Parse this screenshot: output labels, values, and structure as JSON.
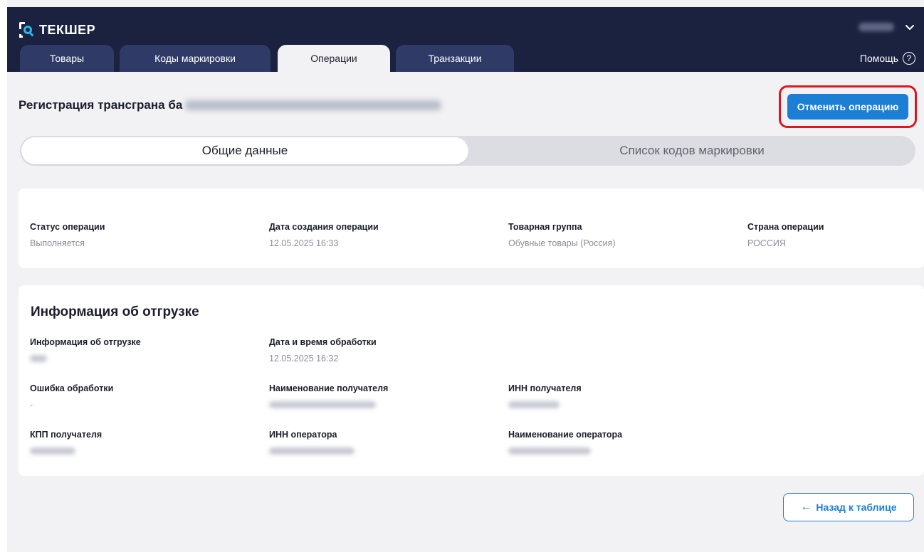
{
  "app": {
    "logo_text": "ТЕКШЕР"
  },
  "header": {
    "tabs": [
      {
        "label": "Товары",
        "active": false
      },
      {
        "label": "Коды маркировки",
        "active": false
      },
      {
        "label": "Операции",
        "active": true
      },
      {
        "label": "Транзакции",
        "active": false
      }
    ],
    "help_label": "Помощь",
    "help_icon_glyph": "?"
  },
  "page": {
    "title": "Регистрация трансграна ба",
    "cancel_label": "Отменить операцию",
    "back_label": "Назад к таблице",
    "back_arrow": "←"
  },
  "segments": [
    {
      "label": "Общие данные",
      "active": true
    },
    {
      "label": "Список кодов маркировки",
      "active": false
    }
  ],
  "status_card": {
    "fields": [
      {
        "label": "Статус операции",
        "value": "Выполняется"
      },
      {
        "label": "Дата создания операции",
        "value": "12.05.2025 16:33"
      },
      {
        "label": "Товарная группа",
        "value": "Обувные товары (Россия)"
      },
      {
        "label": "Страна операции",
        "value": "РОССИЯ"
      }
    ]
  },
  "shipment": {
    "title": "Информация об отгрузке",
    "fields": [
      {
        "label": "Информация об отгрузке"
      },
      {
        "label": "Дата и время обработки",
        "value": "12.05.2025 16:32"
      },
      {
        "label": "Ошибка обработки",
        "value": "-"
      },
      {
        "label": "Наименование получателя"
      },
      {
        "label": "ИНН получателя"
      },
      {
        "label": "КПП получателя"
      },
      {
        "label": "ИНН оператора"
      },
      {
        "label": "Наименование оператора"
      }
    ]
  },
  "colors": {
    "header_bg": "#1b2240",
    "tab_bg": "#2f3a67",
    "accent": "#1c7fd4",
    "highlight": "#e0161e",
    "page_bg": "#f2f2f5"
  },
  "icons": {
    "logo": "tekshher-logo-icon",
    "user_menu": "chevron-down-icon",
    "help": "question-circle-icon",
    "back": "arrow-left-icon"
  }
}
